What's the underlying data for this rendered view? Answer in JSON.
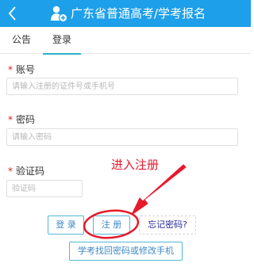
{
  "header": {
    "title": "广东省普通高考/学考报名",
    "back_icon": "chevron-left-icon",
    "logo_icon": "user-add-icon",
    "bg_color": "#1e9fe9"
  },
  "tabs": [
    {
      "label": "公告",
      "active": false
    },
    {
      "label": "登录",
      "active": true
    }
  ],
  "form": {
    "account": {
      "required_mark": "*",
      "label": "账号",
      "placeholder": "请输入注册的证件号或手机号",
      "value": ""
    },
    "password": {
      "required_mark": "*",
      "label": "密码",
      "placeholder": "请输入密码",
      "value": ""
    },
    "captcha": {
      "required_mark": "*",
      "label": "验证码",
      "placeholder": "验证码",
      "value": ""
    }
  },
  "buttons": {
    "login": "登 录",
    "register": "注 册",
    "forgot": "忘记密码?",
    "recover": "学考找回密码或修改手机"
  },
  "annotation": {
    "text": "进入注册",
    "color": "#e8192c"
  }
}
